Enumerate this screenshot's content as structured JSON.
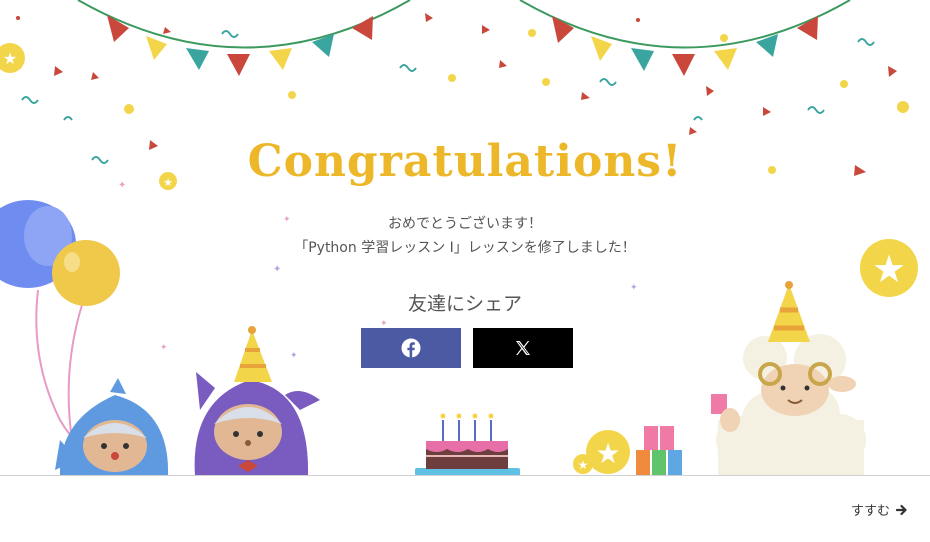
{
  "title": "Congratulations!",
  "message_line1": "おめでとうございます！",
  "message_line2": "「Python 学習レッスン I」レッスンを修了しました！",
  "share": {
    "heading": "友達にシェア",
    "facebook_icon": "facebook-icon",
    "x_icon": "x-icon"
  },
  "next_label": "すすむ",
  "next_icon": "arrow-right-icon",
  "colors": {
    "title": "#ecb82a",
    "facebook": "#4c5aa3",
    "x": "#000000",
    "red": "#c9473b",
    "yellow": "#f3d54a",
    "teal": "#3aa59f"
  }
}
